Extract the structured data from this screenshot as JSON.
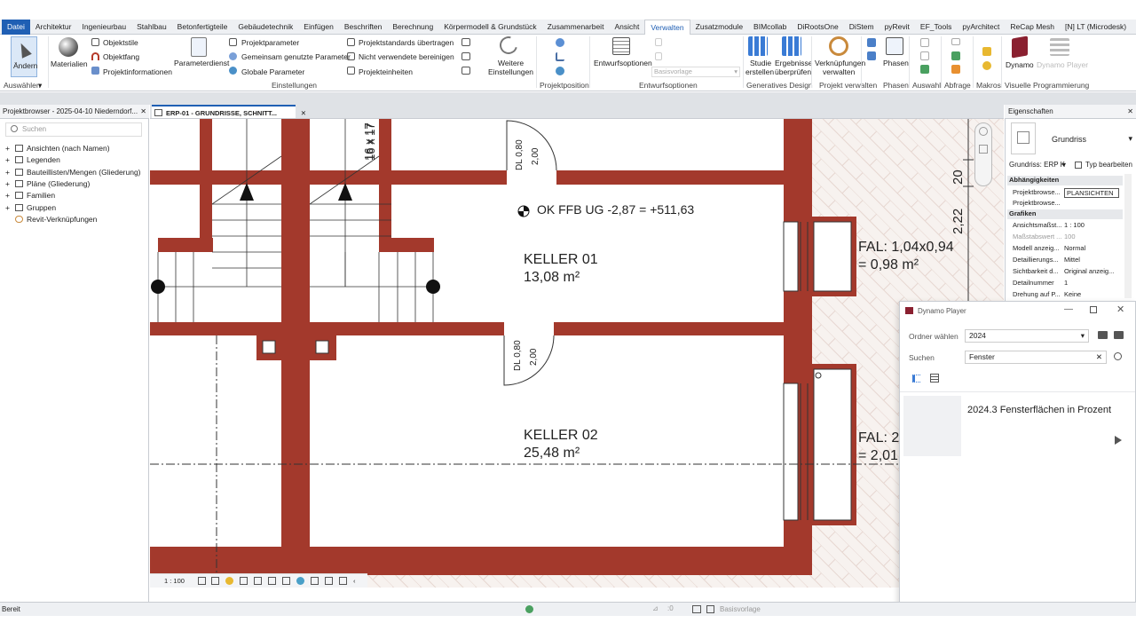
{
  "menu": {
    "tabs": [
      "Datei",
      "Architektur",
      "Ingenieurbau",
      "Stahlbau",
      "Betonfertigteile",
      "Gebäudetechnik",
      "Einfügen",
      "Beschriften",
      "Berechnung",
      "Körpermodell & Grundstück",
      "Zusammenarbeit",
      "Ansicht",
      "Verwalten",
      "Zusatzmodule",
      "BIMcollab",
      "DiRootsOne",
      "DiStem",
      "pyRevit",
      "EF_Tools",
      "pyArchitect",
      "ReCap Mesh",
      "[N] LT (Microdesk)"
    ],
    "active": "Verwalten",
    "overflow": "⏵⏵ ◉ ▾"
  },
  "ribbon": {
    "aendern": "Ändern",
    "auswaehlen": "Auswählen",
    "materialien": "Materialien",
    "objektstile": "Objektstile",
    "objektfang": "Objektfang",
    "projektinformationen": "Projektinformationen",
    "parameterdienst": "Parameterdienst",
    "projektparameter": "Projektparameter",
    "gemeinsam": "Gemeinsam genutzte Parameter",
    "globale": "Globale  Parameter",
    "projektstandards": "Projektstandards übertragen",
    "nicht_verwendete": "Nicht verwendete bereinigen",
    "projekteinheiten": "Projekteinheiten",
    "einstellungen_group": "Einstellungen",
    "weitere": "Weitere",
    "einstellungen": "Einstellungen",
    "projektposition": "Projektposition",
    "entwurfsoptionen_btn": "Entwurfsoptionen",
    "basisvorlage": "Basisvorlage",
    "entwurfsoptionen_group": "Entwurfsoptionen",
    "studie": "Studie",
    "erstellen": "erstellen",
    "ergebnisse": "Ergebnisse",
    "ueberpruefen": "überprüfen",
    "generatives": "Generatives Design",
    "verknuepfungen": "Verknüpfungen",
    "verwalten": "verwalten",
    "projekt_verwalten": "Projekt verwalten",
    "phasen": "Phasen",
    "phasen_group": "Phasen",
    "auswahl": "Auswahl",
    "abfrage": "Abfrage",
    "makros": "Makros",
    "dynamo": "Dynamo",
    "dynamo_player": "Dynamo Player",
    "visuelle": "Visuelle Programmierung"
  },
  "project_browser": {
    "title": "Projektbrowser - 2025-04-10 Niederndorf...",
    "search_placeholder": "Suchen",
    "items": [
      "Ansichten (nach Namen)",
      "Legenden",
      "Bauteillisten/Mengen (Gliederung)",
      "Pläne (Gliederung)",
      "Familien",
      "Gruppen",
      "Revit-Verknüpfungen"
    ]
  },
  "view_tab": {
    "label": "ERP-01 - GRUNDRISSE, SCHNITT..."
  },
  "drawing": {
    "stair1": "16 x 17",
    "stair2": "16 x 17",
    "door1_a": "DL 0,80",
    "door1_b": "2,00",
    "door2_a": "DL 0,80",
    "door2_b": "2,00",
    "level": "OK FFB UG -2,87 = +511,63",
    "room1_name": "KELLER 01",
    "room1_area": "13,08 m²",
    "room2_name": "KELLER 02",
    "room2_area": "25,48 m²",
    "fal1_a": "FAL: 1,04x0,94",
    "fal1_b": "= 0,98 m²",
    "fal2_a": "FAL: 2",
    "fal2_b": "= 2,01",
    "dim_20": "20",
    "dim_222": "2,22",
    "scale": "1 : 100"
  },
  "properties": {
    "title": "Eigenschaften",
    "type_name": "Grundriss",
    "selector": "Grundriss: ERP K",
    "type_edit": "Typ bearbeiten",
    "sections": {
      "abh": "Abhängigkeiten",
      "graf": "Grafiken"
    },
    "rows": [
      {
        "k": "Projektbrowse...",
        "v": "PLANSICHTEN"
      },
      {
        "k": "Projektbrowse...",
        "v": ""
      },
      {
        "k": "Ansichtsmaßst...",
        "v": "1 : 100"
      },
      {
        "k": "Maßstabswert ...",
        "v": "100"
      },
      {
        "k": "Modell anzeig...",
        "v": "Normal"
      },
      {
        "k": "Detaillierungs...",
        "v": "Mittel"
      },
      {
        "k": "Sichtbarkeit d...",
        "v": "Original anzeig..."
      },
      {
        "k": "Detailnummer",
        "v": "1"
      },
      {
        "k": "Drehung auf P...",
        "v": "Keine"
      }
    ]
  },
  "dynamo_player": {
    "title": "Dynamo Player",
    "folder_label": "Ordner wählen",
    "folder_value": "2024",
    "search_label": "Suchen",
    "search_value": "Fenster",
    "script_name": "2024.3 Fensterflächen in Prozent"
  },
  "status": {
    "text": "Bereit",
    "model": "Basisvorlage",
    "coord": ":0"
  }
}
